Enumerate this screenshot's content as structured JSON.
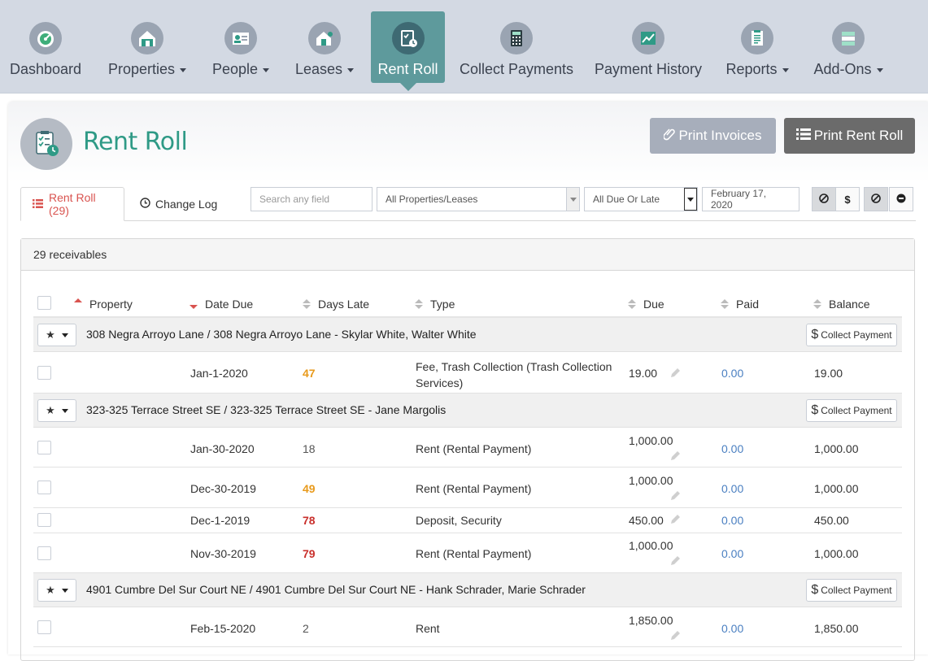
{
  "nav": {
    "items": [
      {
        "label": "Dashboard",
        "caret": false,
        "icon": "gauge-icon"
      },
      {
        "label": "Properties",
        "caret": true,
        "icon": "house-icon"
      },
      {
        "label": "People",
        "caret": true,
        "icon": "id-card-icon"
      },
      {
        "label": "Leases",
        "caret": true,
        "icon": "house-key-icon"
      },
      {
        "label": "Rent Roll",
        "caret": false,
        "icon": "clipboard-clock-icon",
        "active": true
      },
      {
        "label": "Collect Payments",
        "caret": false,
        "icon": "calculator-icon"
      },
      {
        "label": "Payment History",
        "caret": false,
        "icon": "line-chart-icon"
      },
      {
        "label": "Reports",
        "caret": true,
        "icon": "report-icon"
      },
      {
        "label": "Add-Ons",
        "caret": true,
        "icon": "stack-icon"
      }
    ]
  },
  "page": {
    "title": "Rent Roll",
    "print_invoices": "Print Invoices",
    "print_rent_roll": "Print Rent Roll"
  },
  "tabs": {
    "rent_roll": "Rent Roll (29)",
    "change_log": "Change Log"
  },
  "filters": {
    "search_placeholder": "Search any field",
    "properties": "All Properties/Leases",
    "due": "All Due Or Late",
    "date": "February 17, 2020"
  },
  "table": {
    "count_label": "29 receivables",
    "headers": {
      "property": "Property",
      "date_due": "Date Due",
      "days_late": "Days Late",
      "type": "Type",
      "due": "Due",
      "paid": "Paid",
      "balance": "Balance"
    },
    "collect_label": "Collect Payment",
    "groups": [
      {
        "title": "308 Negra Arroyo Lane / 308 Negra Arroyo Lane - Skylar White, Walter White",
        "rows": [
          {
            "date": "Jan-1-2020",
            "late": "47",
            "late_class": "late-orange",
            "type_line1": "Fee, Trash Collection (Trash Collection",
            "type_line2": "Services)",
            "due": "19.00",
            "paid": "0.00",
            "balance": "19.00"
          }
        ]
      },
      {
        "title": "323-325 Terrace Street SE / 323-325 Terrace Street SE - Jane Margolis",
        "rows": [
          {
            "date": "Jan-30-2020",
            "late": "18",
            "late_class": "late-plain",
            "type_line1": "Rent (Rental Payment)",
            "due": "1,000.00",
            "paid": "0.00",
            "balance": "1,000.00"
          },
          {
            "date": "Dec-30-2019",
            "late": "49",
            "late_class": "late-orange",
            "type_line1": "Rent (Rental Payment)",
            "due": "1,000.00",
            "paid": "0.00",
            "balance": "1,000.00"
          },
          {
            "date": "Dec-1-2019",
            "late": "78",
            "late_class": "late-red",
            "type_line1": "Deposit, Security",
            "due": "450.00",
            "paid": "0.00",
            "balance": "450.00"
          },
          {
            "date": "Nov-30-2019",
            "late": "79",
            "late_class": "late-red",
            "type_line1": "Rent (Rental Payment)",
            "due": "1,000.00",
            "paid": "0.00",
            "balance": "1,000.00"
          }
        ]
      },
      {
        "title": "4901 Cumbre Del Sur Court NE / 4901 Cumbre Del Sur Court NE - Hank Schrader, Marie Schrader",
        "rows": [
          {
            "date": "Feb-15-2020",
            "late": "2",
            "late_class": "late-plain",
            "type_line1": "Rent",
            "due": "1,850.00",
            "paid": "0.00",
            "balance": "1,850.00"
          }
        ]
      }
    ]
  },
  "colors": {
    "accent": "#2f9a86",
    "nav_active": "#5e9a9c",
    "late_orange": "#e89a1c",
    "late_red": "#c9302c",
    "paid_blue": "#4a7fc1"
  }
}
